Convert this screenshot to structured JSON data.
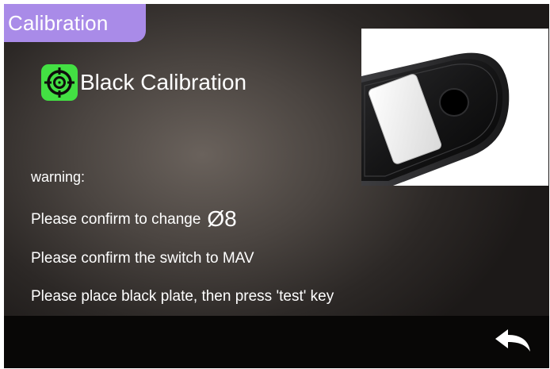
{
  "header": {
    "title": "Calibration"
  },
  "calibration": {
    "heading": "Black Calibration",
    "heading_icon": "target-icon",
    "heading_icon_color": "#43e043"
  },
  "messages": {
    "warning_label": "warning:",
    "change_text": "Please confirm to change",
    "aperture_value": "Ø8",
    "switch_text": "Please confirm the switch to MAV",
    "place_text": "Please place black plate, then press 'test' key"
  },
  "footer": {
    "back_icon": "back-arrow-icon"
  },
  "colors": {
    "title_tab": "#a98be8",
    "accent_green": "#43e043",
    "text": "#ffffff",
    "bottom_bar": "#080706"
  }
}
